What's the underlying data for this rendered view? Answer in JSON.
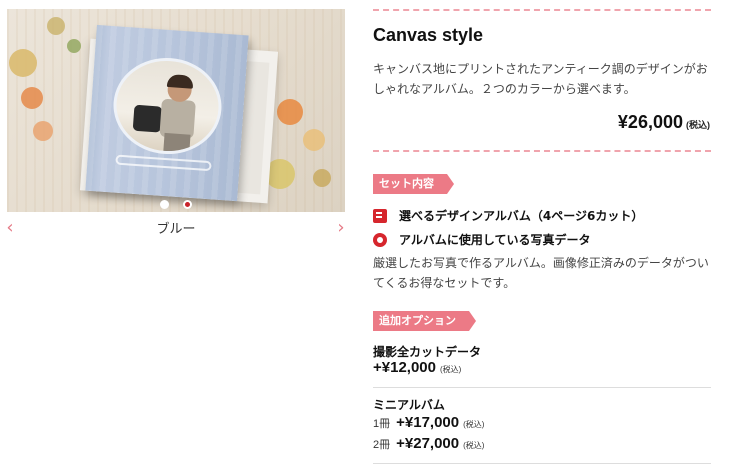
{
  "slider": {
    "caption": "ブルー",
    "prev_icon": "chevron-left-icon",
    "next_icon": "chevron-right-icon",
    "dots": 2,
    "active_dot": 2
  },
  "product": {
    "title": "Canvas style",
    "description": "キャンバス地にプリントされたアンティーク調のデザインがおしゃれなアルバム。２つのカラーから選べます。",
    "price": "¥26,000",
    "tax_note": "(税込)"
  },
  "set": {
    "tag": "セット内容",
    "items": [
      {
        "icon": "book-icon",
        "label": "選べるデザインアルバム（4ページ6カット）"
      },
      {
        "icon": "disc-icon",
        "label": "アルバムに使用している写真データ"
      }
    ],
    "description": "厳選したお写真で作るアルバム。画像修正済みのデータがついてくるお得なセットです。"
  },
  "options": {
    "tag": "追加オプション",
    "items": [
      {
        "name": "撮影全カットデータ",
        "prices": [
          {
            "prefix": "",
            "price": "+¥12,000",
            "tax": "(税込)"
          }
        ]
      },
      {
        "name": "ミニアルバム",
        "prices": [
          {
            "prefix": "1冊",
            "price": "+¥17,000",
            "tax": "(税込)"
          },
          {
            "prefix": "2冊",
            "price": "+¥27,000",
            "tax": "(税込)"
          }
        ]
      }
    ]
  },
  "colors": {
    "accent": "#ec7a86",
    "dashed_divider": "#f0a4ad",
    "icon_red": "#d6262d",
    "active_dot": "#c8232b"
  }
}
